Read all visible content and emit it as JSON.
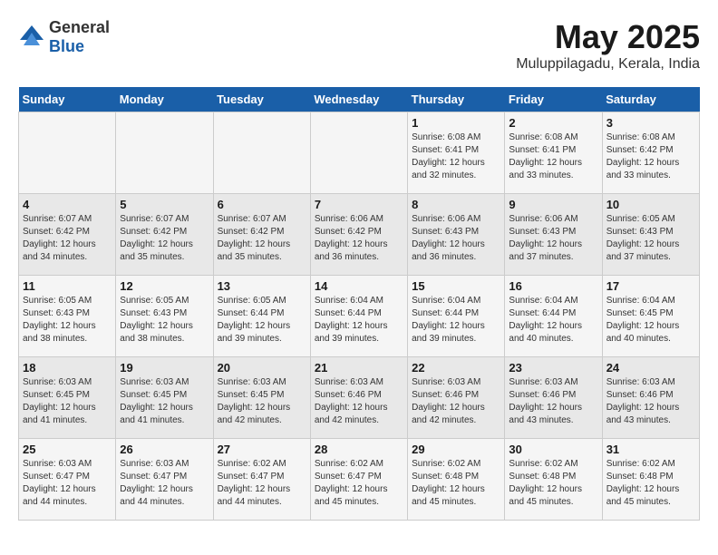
{
  "logo": {
    "text_general": "General",
    "text_blue": "Blue"
  },
  "title": "May 2025",
  "subtitle": "Muluppilagadu, Kerala, India",
  "weekdays": [
    "Sunday",
    "Monday",
    "Tuesday",
    "Wednesday",
    "Thursday",
    "Friday",
    "Saturday"
  ],
  "weeks": [
    [
      {
        "day": "",
        "info": ""
      },
      {
        "day": "",
        "info": ""
      },
      {
        "day": "",
        "info": ""
      },
      {
        "day": "",
        "info": ""
      },
      {
        "day": "1",
        "info": "Sunrise: 6:08 AM\nSunset: 6:41 PM\nDaylight: 12 hours\nand 32 minutes."
      },
      {
        "day": "2",
        "info": "Sunrise: 6:08 AM\nSunset: 6:41 PM\nDaylight: 12 hours\nand 33 minutes."
      },
      {
        "day": "3",
        "info": "Sunrise: 6:08 AM\nSunset: 6:42 PM\nDaylight: 12 hours\nand 33 minutes."
      }
    ],
    [
      {
        "day": "4",
        "info": "Sunrise: 6:07 AM\nSunset: 6:42 PM\nDaylight: 12 hours\nand 34 minutes."
      },
      {
        "day": "5",
        "info": "Sunrise: 6:07 AM\nSunset: 6:42 PM\nDaylight: 12 hours\nand 35 minutes."
      },
      {
        "day": "6",
        "info": "Sunrise: 6:07 AM\nSunset: 6:42 PM\nDaylight: 12 hours\nand 35 minutes."
      },
      {
        "day": "7",
        "info": "Sunrise: 6:06 AM\nSunset: 6:42 PM\nDaylight: 12 hours\nand 36 minutes."
      },
      {
        "day": "8",
        "info": "Sunrise: 6:06 AM\nSunset: 6:43 PM\nDaylight: 12 hours\nand 36 minutes."
      },
      {
        "day": "9",
        "info": "Sunrise: 6:06 AM\nSunset: 6:43 PM\nDaylight: 12 hours\nand 37 minutes."
      },
      {
        "day": "10",
        "info": "Sunrise: 6:05 AM\nSunset: 6:43 PM\nDaylight: 12 hours\nand 37 minutes."
      }
    ],
    [
      {
        "day": "11",
        "info": "Sunrise: 6:05 AM\nSunset: 6:43 PM\nDaylight: 12 hours\nand 38 minutes."
      },
      {
        "day": "12",
        "info": "Sunrise: 6:05 AM\nSunset: 6:43 PM\nDaylight: 12 hours\nand 38 minutes."
      },
      {
        "day": "13",
        "info": "Sunrise: 6:05 AM\nSunset: 6:44 PM\nDaylight: 12 hours\nand 39 minutes."
      },
      {
        "day": "14",
        "info": "Sunrise: 6:04 AM\nSunset: 6:44 PM\nDaylight: 12 hours\nand 39 minutes."
      },
      {
        "day": "15",
        "info": "Sunrise: 6:04 AM\nSunset: 6:44 PM\nDaylight: 12 hours\nand 39 minutes."
      },
      {
        "day": "16",
        "info": "Sunrise: 6:04 AM\nSunset: 6:44 PM\nDaylight: 12 hours\nand 40 minutes."
      },
      {
        "day": "17",
        "info": "Sunrise: 6:04 AM\nSunset: 6:45 PM\nDaylight: 12 hours\nand 40 minutes."
      }
    ],
    [
      {
        "day": "18",
        "info": "Sunrise: 6:03 AM\nSunset: 6:45 PM\nDaylight: 12 hours\nand 41 minutes."
      },
      {
        "day": "19",
        "info": "Sunrise: 6:03 AM\nSunset: 6:45 PM\nDaylight: 12 hours\nand 41 minutes."
      },
      {
        "day": "20",
        "info": "Sunrise: 6:03 AM\nSunset: 6:45 PM\nDaylight: 12 hours\nand 42 minutes."
      },
      {
        "day": "21",
        "info": "Sunrise: 6:03 AM\nSunset: 6:46 PM\nDaylight: 12 hours\nand 42 minutes."
      },
      {
        "day": "22",
        "info": "Sunrise: 6:03 AM\nSunset: 6:46 PM\nDaylight: 12 hours\nand 42 minutes."
      },
      {
        "day": "23",
        "info": "Sunrise: 6:03 AM\nSunset: 6:46 PM\nDaylight: 12 hours\nand 43 minutes."
      },
      {
        "day": "24",
        "info": "Sunrise: 6:03 AM\nSunset: 6:46 PM\nDaylight: 12 hours\nand 43 minutes."
      }
    ],
    [
      {
        "day": "25",
        "info": "Sunrise: 6:03 AM\nSunset: 6:47 PM\nDaylight: 12 hours\nand 44 minutes."
      },
      {
        "day": "26",
        "info": "Sunrise: 6:03 AM\nSunset: 6:47 PM\nDaylight: 12 hours\nand 44 minutes."
      },
      {
        "day": "27",
        "info": "Sunrise: 6:02 AM\nSunset: 6:47 PM\nDaylight: 12 hours\nand 44 minutes."
      },
      {
        "day": "28",
        "info": "Sunrise: 6:02 AM\nSunset: 6:47 PM\nDaylight: 12 hours\nand 45 minutes."
      },
      {
        "day": "29",
        "info": "Sunrise: 6:02 AM\nSunset: 6:48 PM\nDaylight: 12 hours\nand 45 minutes."
      },
      {
        "day": "30",
        "info": "Sunrise: 6:02 AM\nSunset: 6:48 PM\nDaylight: 12 hours\nand 45 minutes."
      },
      {
        "day": "31",
        "info": "Sunrise: 6:02 AM\nSunset: 6:48 PM\nDaylight: 12 hours\nand 45 minutes."
      }
    ]
  ]
}
